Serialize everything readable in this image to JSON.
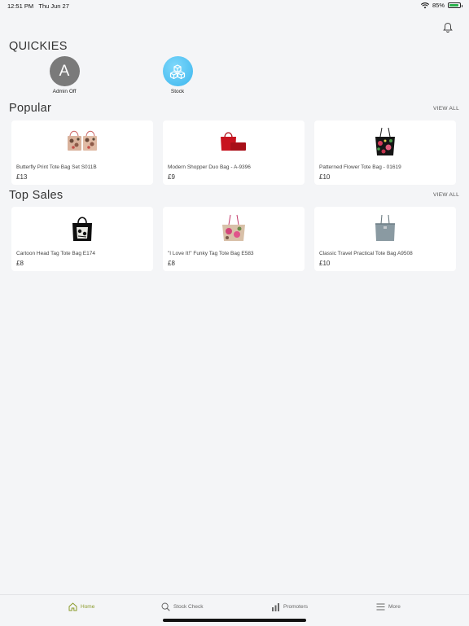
{
  "status": {
    "time": "12:51 PM",
    "date": "Thu Jun 27",
    "battery": "85%"
  },
  "quickies": {
    "title": "QUICKIES",
    "items": [
      {
        "letter": "A",
        "label": "Admin Off"
      },
      {
        "label": "Stock"
      }
    ]
  },
  "popular": {
    "title": "Popular",
    "view_all": "VIEW ALL",
    "products": [
      {
        "name": "Butterfly Print Tote Bag Set S011B",
        "price": "£13"
      },
      {
        "name": "Modern Shopper Duo Bag - A-9396",
        "price": "£9"
      },
      {
        "name": "Patterned Flower Tote Bag - 01619",
        "price": "£10"
      }
    ]
  },
  "top_sales": {
    "title": "Top Sales",
    "view_all": "VIEW ALL",
    "products": [
      {
        "name": "Cartoon Head Tag Tote Bag E174",
        "price": "£8"
      },
      {
        "name": "\"I Love It!\" Funky Tag Tote Bag E583",
        "price": "£8"
      },
      {
        "name": "Classic Travel Practical Tote Bag A9508",
        "price": "£10"
      }
    ]
  },
  "tabbar": {
    "home": "Home",
    "stock_check": "Stock Check",
    "promoters": "Promoters",
    "more": "More"
  },
  "colors": {
    "accent": "#8a9a2a",
    "stock_circle": "#4fc3f7",
    "avatar": "#7a7a7a"
  }
}
